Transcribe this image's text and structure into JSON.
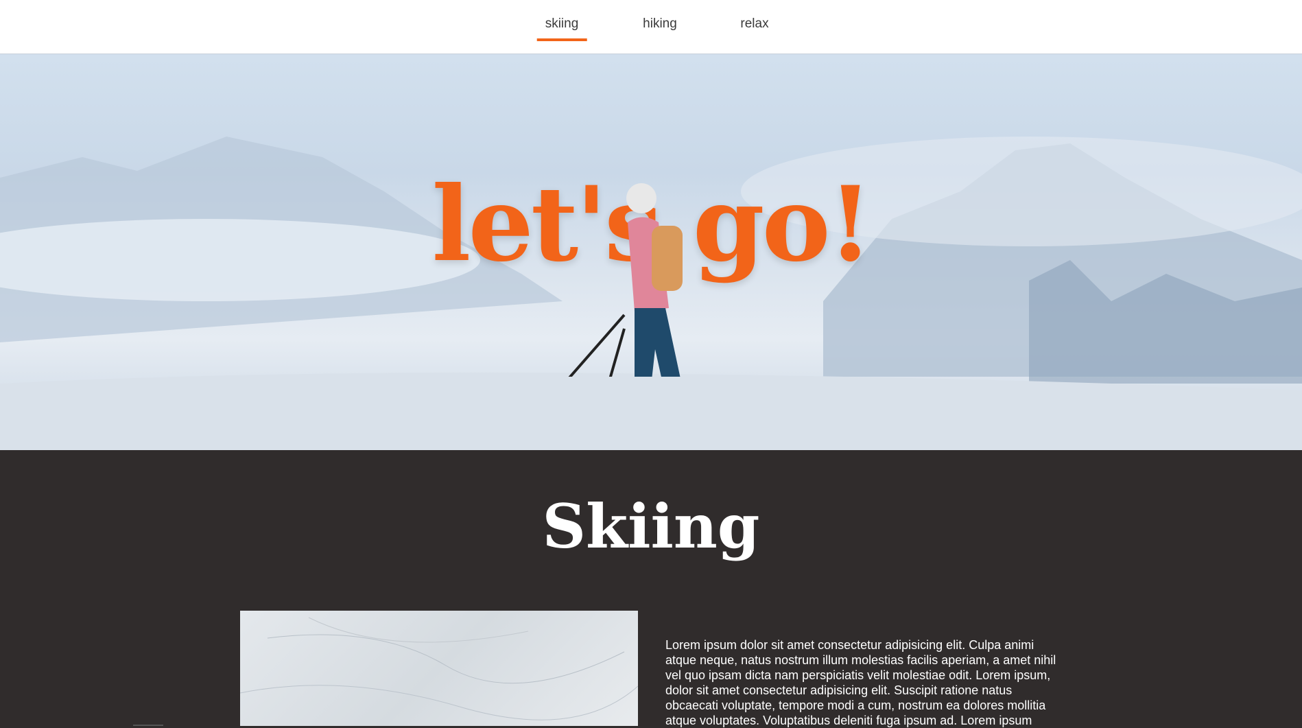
{
  "nav": {
    "tabs": [
      {
        "label": "skiing",
        "active": true
      },
      {
        "label": "hiking",
        "active": false
      },
      {
        "label": "relax",
        "active": false
      }
    ]
  },
  "hero": {
    "title": "let's go!"
  },
  "colors": {
    "accent": "#f26419",
    "section_bg": "#302c2c"
  },
  "section": {
    "title": "Skiing",
    "text": "Lorem ipsum dolor sit amet consectetur adipisicing elit. Culpa animi atque neque, natus nostrum illum molestias facilis aperiam, a amet nihil vel quo ipsam dicta nam perspiciatis velit molestiae odit. Lorem ipsum, dolor sit amet consectetur adipisicing elit. Suscipit ratione natus obcaecati voluptate, tempore modi a cum, nostrum ea dolores mollitia atque voluptates. Voluptatibus deleniti fuga ipsum ad. Lorem ipsum"
  }
}
